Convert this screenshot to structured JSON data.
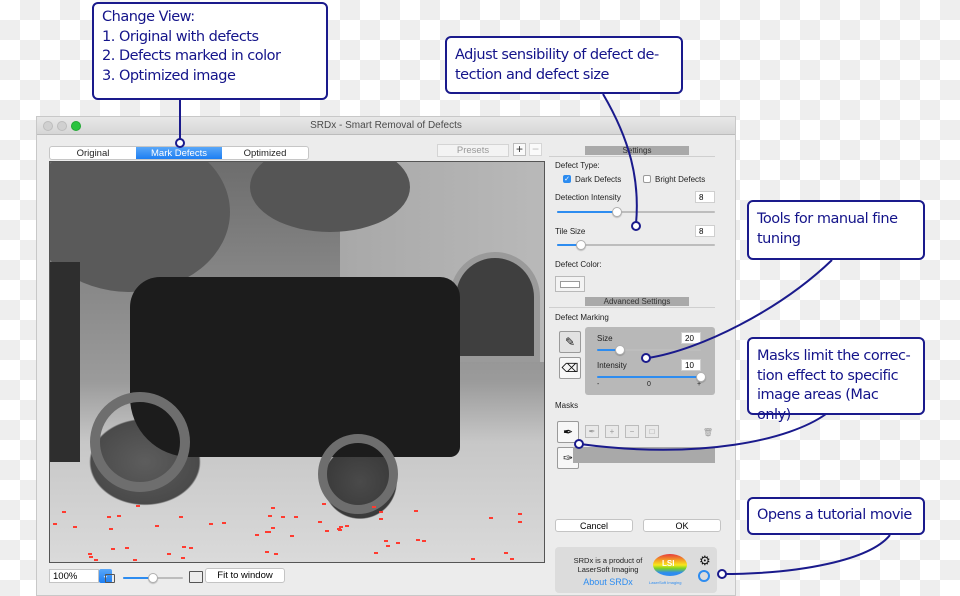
{
  "window": {
    "title": "SRDx - Smart Removal of Defects"
  },
  "view_tabs": [
    {
      "label": "Original",
      "active": false
    },
    {
      "label": "Mark Defects",
      "active": true
    },
    {
      "label": "Optimized",
      "active": false
    }
  ],
  "presets": {
    "label": "Presets",
    "add": "+",
    "remove": "−"
  },
  "image": {
    "description": "Black-and-white photo of vintage electric car with passengers; red defect markings on ground",
    "marker_color": "#ff3b30"
  },
  "bottom_bar": {
    "zoom_value": "100%",
    "zoom_slider_fraction": 0.5,
    "fit_label": "Fit to window"
  },
  "settings": {
    "header": "Settings",
    "defect_type_label": "Defect Type:",
    "dark_defects": {
      "label": "Dark Defects",
      "checked": true
    },
    "bright_defects": {
      "label": "Bright Defects",
      "checked": false
    },
    "detection_intensity": {
      "label": "Detection Intensity",
      "value": "8",
      "fraction": 0.38
    },
    "tile_size": {
      "label": "Tile Size",
      "value": "8",
      "fraction": 0.15
    },
    "defect_color_label": "Defect Color:"
  },
  "advanced": {
    "header": "Advanced Settings",
    "defect_marking_label": "Defect Marking",
    "size": {
      "label": "Size",
      "value": "20",
      "fraction": 0.22
    },
    "intensity": {
      "label": "Intensity",
      "value": "10",
      "fraction": 1.0,
      "min_label": "-",
      "mid_label": "0",
      "max_label": "+"
    },
    "masks_label": "Masks"
  },
  "buttons": {
    "cancel": "Cancel",
    "ok": "OK"
  },
  "about": {
    "line1": "SRDx is a product of",
    "line2": "LaserSoft Imaging",
    "link": "About SRDx",
    "logo_text": "LSI",
    "logo_caption": "LaserSoft Imaging"
  },
  "callouts": {
    "change_view": [
      "Change View:",
      "1. Original with defects",
      "2. Defects marked in color",
      "3. Optimized image"
    ],
    "sensibility": [
      "Adjust sensibility of defect de-",
      "tection and defect size"
    ],
    "tools": [
      "Tools for manual fine",
      "tuning"
    ],
    "masks": [
      "Masks limit the correc-",
      "tion effect to specific",
      "image areas (Mac only)"
    ],
    "tutorial": [
      "Opens a tutorial movie"
    ]
  },
  "colors": {
    "accent": "#1d7ef2",
    "callout": "#1a1a8c"
  }
}
